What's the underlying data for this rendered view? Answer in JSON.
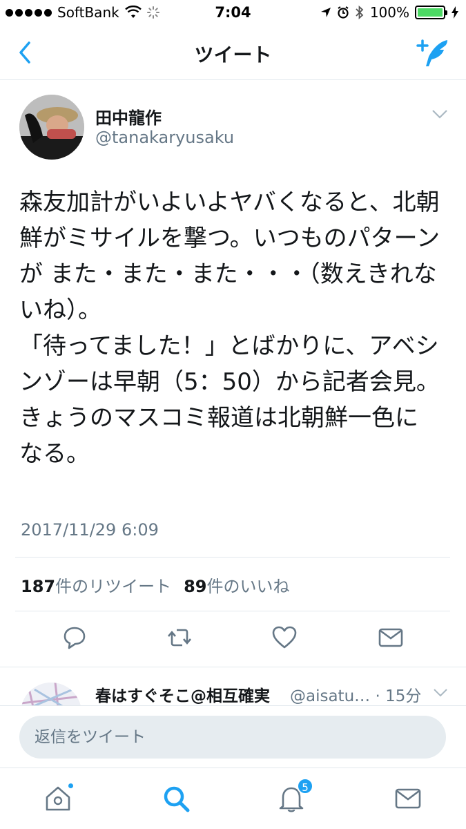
{
  "status_bar": {
    "carrier": "SoftBank",
    "time": "7:04",
    "battery": "100%"
  },
  "nav": {
    "title": "ツイート"
  },
  "tweet": {
    "display_name": "田中龍作",
    "handle": "@tanakaryusaku",
    "text": "森友加計がいよいよヤバくなると、北朝鮮がミサイルを撃つ。いつものパターンが また・また・また・・・（数えきれないね）。\n「待ってました！」とばかりに、アベシンゾーは早朝（5：50）から記者会見。きょうのマスコミ報道は北朝鮮一色になる。",
    "timestamp": "2017/11/29 6:09",
    "retweet_count": "187",
    "retweet_label": "件のリツイート",
    "like_count": "89",
    "like_label": "件のいいね"
  },
  "reply_preview": {
    "name": "春はすぐそこ@相互確実",
    "handle_time": "@aisatu… · 15分"
  },
  "composer": {
    "placeholder": "返信をツイート"
  },
  "tab_bar": {
    "notification_badge": "5"
  },
  "colors": {
    "accent": "#1da1f2",
    "secondary_text": "#657786",
    "divider": "#e1e8ed",
    "battery": "#4cd964"
  }
}
